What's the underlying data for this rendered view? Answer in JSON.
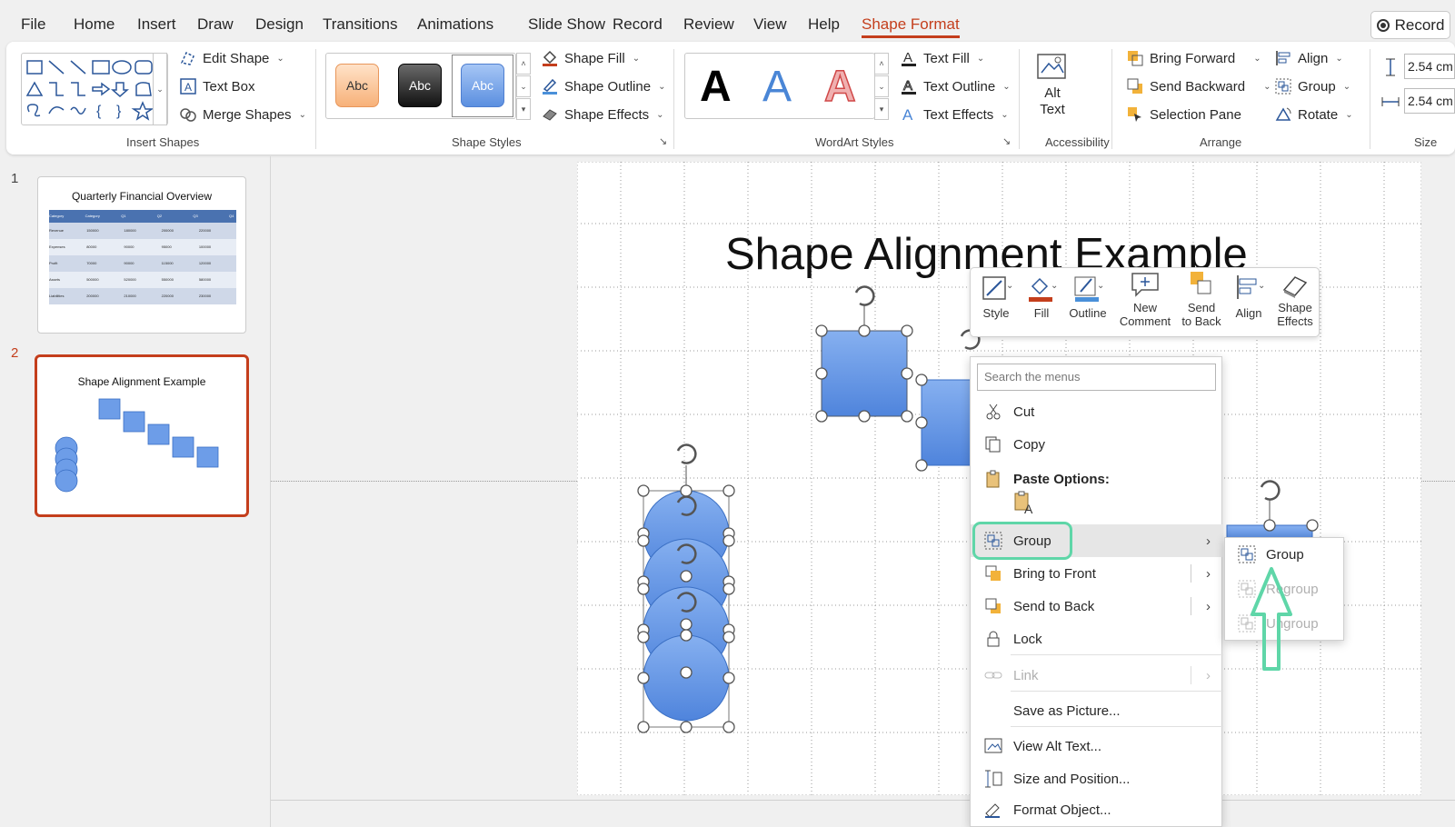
{
  "tabs": [
    "File",
    "Home",
    "Insert",
    "Draw",
    "Design",
    "Transitions",
    "Animations",
    "Slide Show",
    "Record",
    "Review",
    "View",
    "Help",
    "Shape Format"
  ],
  "active_tab": "Shape Format",
  "record_button": "Record",
  "ribbon": {
    "insert_shapes": {
      "label": "Insert Shapes",
      "edit_shape": "Edit Shape",
      "text_box": "Text Box",
      "merge_shapes": "Merge Shapes"
    },
    "shape_styles": {
      "label": "Shape Styles",
      "presets": [
        "Abc",
        "Abc",
        "Abc"
      ],
      "shape_fill": "Shape Fill",
      "shape_outline": "Shape Outline",
      "shape_effects": "Shape Effects"
    },
    "wordart_styles": {
      "label": "WordArt Styles",
      "letters": [
        "A",
        "A",
        "A"
      ],
      "text_fill": "Text Fill",
      "text_outline": "Text Outline",
      "text_effects": "Text Effects"
    },
    "accessibility": {
      "label": "Accessibility",
      "alt_text_1": "Alt",
      "alt_text_2": "Text"
    },
    "arrange": {
      "label": "Arrange",
      "bring_forward": "Bring Forward",
      "send_backward": "Send Backward",
      "selection_pane": "Selection Pane",
      "align": "Align",
      "group": "Group",
      "rotate": "Rotate"
    },
    "size": {
      "label": "Size",
      "height": "2.54 cm",
      "width": "2.54 cm"
    }
  },
  "slides": [
    {
      "number": "1",
      "title": "Quarterly Financial Overview",
      "table_header": [
        "Category",
        "Category",
        "Q1",
        "Q2",
        "Q3",
        "Q4"
      ],
      "table_rows": [
        [
          "Revenue",
          "150000",
          "180000",
          "200000",
          "220000"
        ],
        [
          "Expenses",
          "80000",
          "90000",
          "95000",
          "100000"
        ],
        [
          "Profit",
          "70000",
          "90000",
          "115000",
          "120000"
        ],
        [
          "Assets",
          "500000",
          "520000",
          "550000",
          "580000"
        ],
        [
          "Liabilities",
          "200000",
          "210000",
          "220000",
          "230000"
        ]
      ]
    },
    {
      "number": "2",
      "title": "Shape Alignment Example",
      "selected": true
    }
  ],
  "slide_title": "Shape Alignment Example",
  "mini_toolbar": {
    "style": "Style",
    "fill": "Fill",
    "outline": "Outline",
    "new_comment_1": "New",
    "new_comment_2": "Comment",
    "send_to_back_1": "Send",
    "send_to_back_2": "to Back",
    "align": "Align",
    "shape_effects_1": "Shape",
    "shape_effects_2": "Effects"
  },
  "context_menu": {
    "search_placeholder": "Search the menus",
    "cut": "Cut",
    "copy": "Copy",
    "paste_options": "Paste Options:",
    "group": "Group",
    "bring_to_front": "Bring to Front",
    "send_to_back": "Send to Back",
    "lock": "Lock",
    "link": "Link",
    "save_as_picture": "Save as Picture...",
    "view_alt_text": "View Alt Text...",
    "size_and_position": "Size and Position...",
    "format_object": "Format Object..."
  },
  "group_submenu": {
    "group": "Group",
    "regroup": "Regroup",
    "ungroup": "Ungroup"
  },
  "colors": {
    "accent": "#c43e1c",
    "highlight": "#5fd6a8",
    "shape_fill": "#6d9de8"
  }
}
